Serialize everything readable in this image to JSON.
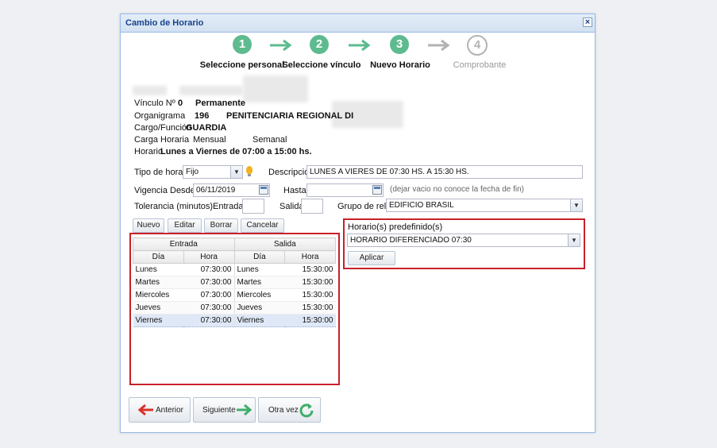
{
  "window": {
    "title": "Cambio de Horario"
  },
  "steps": [
    {
      "number": "1",
      "label": "Seleccione personal",
      "active": true
    },
    {
      "number": "2",
      "label": "Seleccione vínculo",
      "active": true
    },
    {
      "number": "3",
      "label": "Nuevo Horario",
      "active": true
    },
    {
      "number": "4",
      "label": "Comprobante",
      "active": false
    }
  ],
  "info": {
    "vinculo_label": "Vínculo Nº",
    "vinculo_value": "0",
    "vinculo_tipo": "Permanente",
    "organigrama_label": "Organigrama",
    "organigrama_code": "196",
    "organigrama_name": "PENITENCIARIA REGIONAL DI",
    "cargo_label": "Cargo/Función",
    "cargo_value": "GUARDIA",
    "carga_label": "Carga Horaria",
    "carga_mensual": "Mensual",
    "carga_semanal": "Semanal",
    "horario_label": "Horario",
    "horario_value": "Lunes a Viernes de 07:00 a 15:00 hs."
  },
  "form": {
    "tipo_label": "Tipo de horario",
    "tipo_value": "Fijo",
    "descripcion_label": "Descripción",
    "descripcion_value": "LUNES A VIERES DE 07:30 HS. A 15:30 HS.",
    "vigencia_label": "Vigencia",
    "desde_label": "Desde",
    "desde_value": "06/11/2019",
    "hasta_label": "Hasta",
    "hasta_value": "",
    "hasta_hint": "(dejar vacio no conoce la fecha de fin)",
    "tolerancia_label": "Tolerancia (minutos)",
    "entrada_label": "Entrada",
    "entrada_value": "",
    "salida_label": "Salida",
    "salida_value": "",
    "grupo_label": "Grupo de reloj",
    "grupo_value": "EDIFICIO BRASIL"
  },
  "grid_toolbar": {
    "nuevo": "Nuevo",
    "editar": "Editar",
    "borrar": "Borrar",
    "cancelar": "Cancelar"
  },
  "grid": {
    "group_entrada": "Entrada",
    "group_salida": "Salida",
    "col_dia": "Día",
    "col_hora": "Hora",
    "rows": [
      {
        "dia_in": "Lunes",
        "hora_in": "07:30:00",
        "dia_out": "Lunes",
        "hora_out": "15:30:00"
      },
      {
        "dia_in": "Martes",
        "hora_in": "07:30:00",
        "dia_out": "Martes",
        "hora_out": "15:30:00"
      },
      {
        "dia_in": "Miercoles",
        "hora_in": "07:30:00",
        "dia_out": "Miercoles",
        "hora_out": "15:30:00"
      },
      {
        "dia_in": "Jueves",
        "hora_in": "07:30:00",
        "dia_out": "Jueves",
        "hora_out": "15:30:00"
      },
      {
        "dia_in": "Viernes",
        "hora_in": "07:30:00",
        "dia_out": "Viernes",
        "hora_out": "15:30:00"
      }
    ]
  },
  "predefinido": {
    "label": "Horario(s) predefinido(s)",
    "value": "HORARIO DIFERENCIADO 07:30",
    "apply_label": "Aplicar"
  },
  "nav": {
    "anterior": "Anterior",
    "siguiente": "Siguiente",
    "otra_vez": "Otra vez"
  },
  "colors": {
    "step_active": "#5dbb8f",
    "step_inactive": "#b3b3b3",
    "highlight_border": "#c8202a",
    "arrow_back": "#d9322b",
    "arrow_forward": "#3fae6a"
  }
}
